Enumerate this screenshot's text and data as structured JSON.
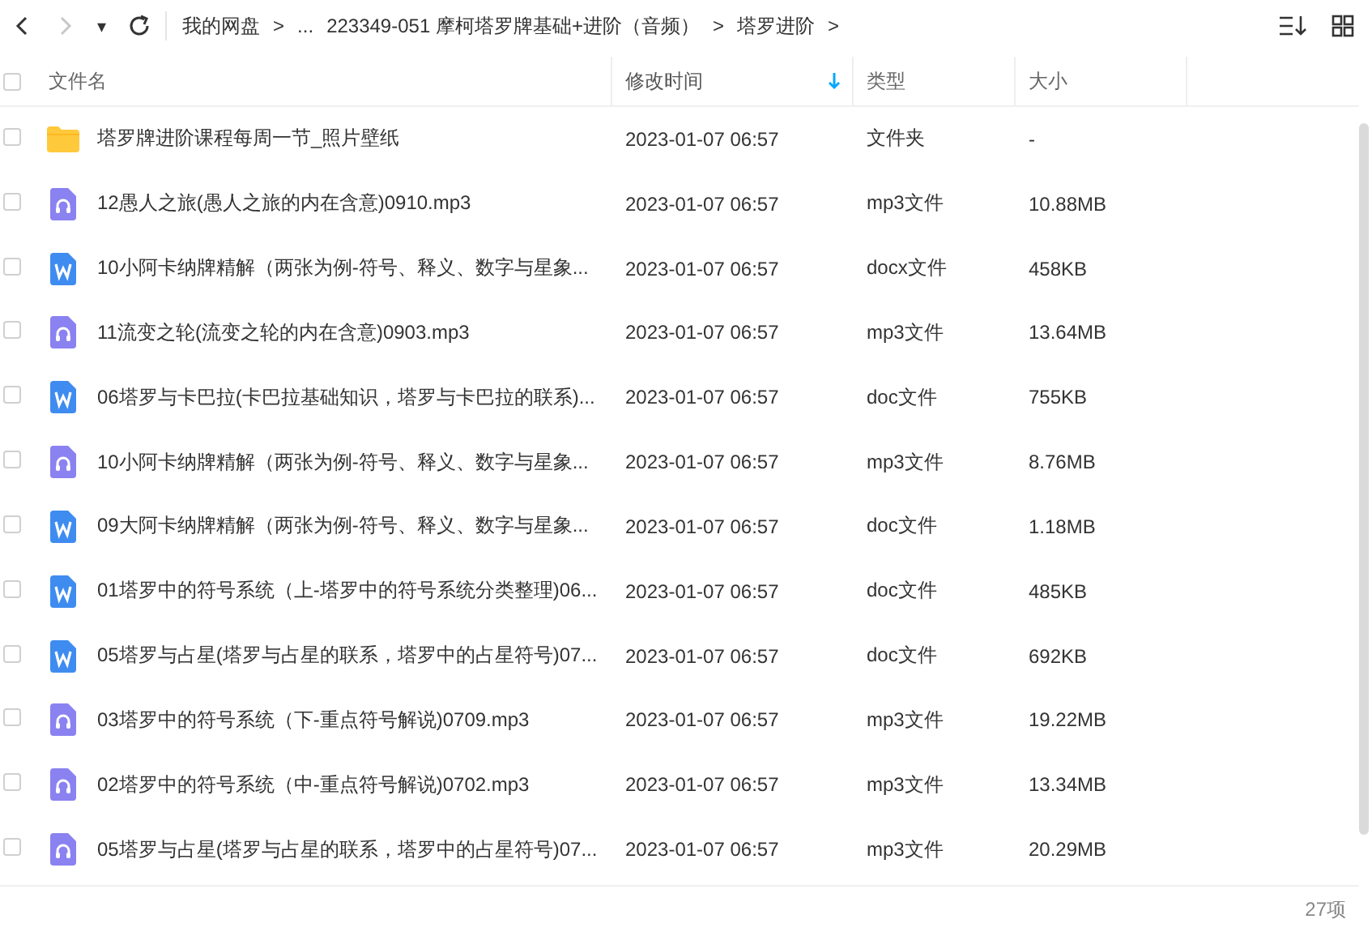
{
  "toolbar": {
    "nav": [
      {
        "kind": "back",
        "disabled": false
      },
      {
        "kind": "forward",
        "disabled": true
      }
    ],
    "history_caret": "▾",
    "breadcrumb": [
      "我的网盘",
      ">",
      "...",
      "223349-051 摩柯塔罗牌基础+进阶（音频）",
      ">",
      "塔罗进阶",
      ">"
    ]
  },
  "table": {
    "select_all": {
      "checked": false
    },
    "columns": [
      {
        "label": "文件名",
        "sorted": false
      },
      {
        "label": "修改时间",
        "sorted": true
      },
      {
        "label": "类型",
        "sorted": false
      },
      {
        "label": "大小",
        "sorted": false
      }
    ],
    "rows": [
      {
        "kind": "folder",
        "checked": false,
        "name": "塔罗牌进阶课程每周一节_照片壁纸",
        "modified": "2023-01-07 06:57",
        "type": "文件夹",
        "size": "-"
      },
      {
        "kind": "audio",
        "checked": false,
        "name": "12愚人之旅(愚人之旅的内在含意)0910.mp3",
        "modified": "2023-01-07 06:57",
        "type": "mp3文件",
        "size": "10.88MB"
      },
      {
        "kind": "doc",
        "checked": false,
        "name": "10小阿卡纳牌精解（两张为例-符号、释义、数字与星象...",
        "modified": "2023-01-07 06:57",
        "type": "docx文件",
        "size": "458KB"
      },
      {
        "kind": "audio",
        "checked": false,
        "name": "11流变之轮(流变之轮的内在含意)0903.mp3",
        "modified": "2023-01-07 06:57",
        "type": "mp3文件",
        "size": "13.64MB"
      },
      {
        "kind": "doc",
        "checked": false,
        "name": "06塔罗与卡巴拉(卡巴拉基础知识，塔罗与卡巴拉的联系)...",
        "modified": "2023-01-07 06:57",
        "type": "doc文件",
        "size": "755KB"
      },
      {
        "kind": "audio",
        "checked": false,
        "name": "10小阿卡纳牌精解（两张为例-符号、释义、数字与星象...",
        "modified": "2023-01-07 06:57",
        "type": "mp3文件",
        "size": "8.76MB"
      },
      {
        "kind": "doc",
        "checked": false,
        "name": "09大阿卡纳牌精解（两张为例-符号、释义、数字与星象...",
        "modified": "2023-01-07 06:57",
        "type": "doc文件",
        "size": "1.18MB"
      },
      {
        "kind": "doc",
        "checked": false,
        "name": "01塔罗中的符号系统（上-塔罗中的符号系统分类整理)06...",
        "modified": "2023-01-07 06:57",
        "type": "doc文件",
        "size": "485KB"
      },
      {
        "kind": "doc",
        "checked": false,
        "name": "05塔罗与占星(塔罗与占星的联系，塔罗中的占星符号)07...",
        "modified": "2023-01-07 06:57",
        "type": "doc文件",
        "size": "692KB"
      },
      {
        "kind": "audio",
        "checked": false,
        "name": "03塔罗中的符号系统（下-重点符号解说)0709.mp3",
        "modified": "2023-01-07 06:57",
        "type": "mp3文件",
        "size": "19.22MB"
      },
      {
        "kind": "audio",
        "checked": false,
        "name": "02塔罗中的符号系统（中-重点符号解说)0702.mp3",
        "modified": "2023-01-07 06:57",
        "type": "mp3文件",
        "size": "13.34MB"
      },
      {
        "kind": "audio",
        "checked": false,
        "name": "05塔罗与占星(塔罗与占星的联系，塔罗中的占星符号)07...",
        "modified": "2023-01-07 06:57",
        "type": "mp3文件",
        "size": "20.29MB"
      }
    ]
  },
  "status_bar": {
    "count": "27项"
  }
}
